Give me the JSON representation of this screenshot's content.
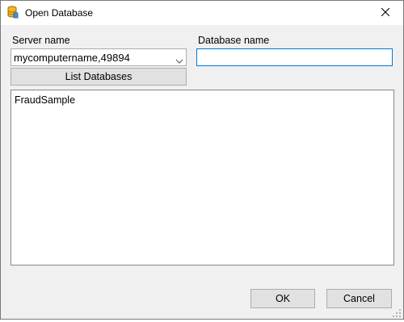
{
  "window": {
    "title": "Open Database",
    "icon": "database-icon",
    "close_icon": "close-icon"
  },
  "server": {
    "label": "Server name",
    "value": "mycomputername,49894"
  },
  "database": {
    "label": "Database name",
    "value": ""
  },
  "buttons": {
    "list_databases": "List Databases",
    "ok": "OK",
    "cancel": "Cancel"
  },
  "databases": [
    "FraudSample"
  ],
  "colors": {
    "focus_border": "#0078d7",
    "dialog_bg": "#f0f0f0",
    "button_bg": "#e1e1e1",
    "icon_yellow": "#f2b824"
  }
}
